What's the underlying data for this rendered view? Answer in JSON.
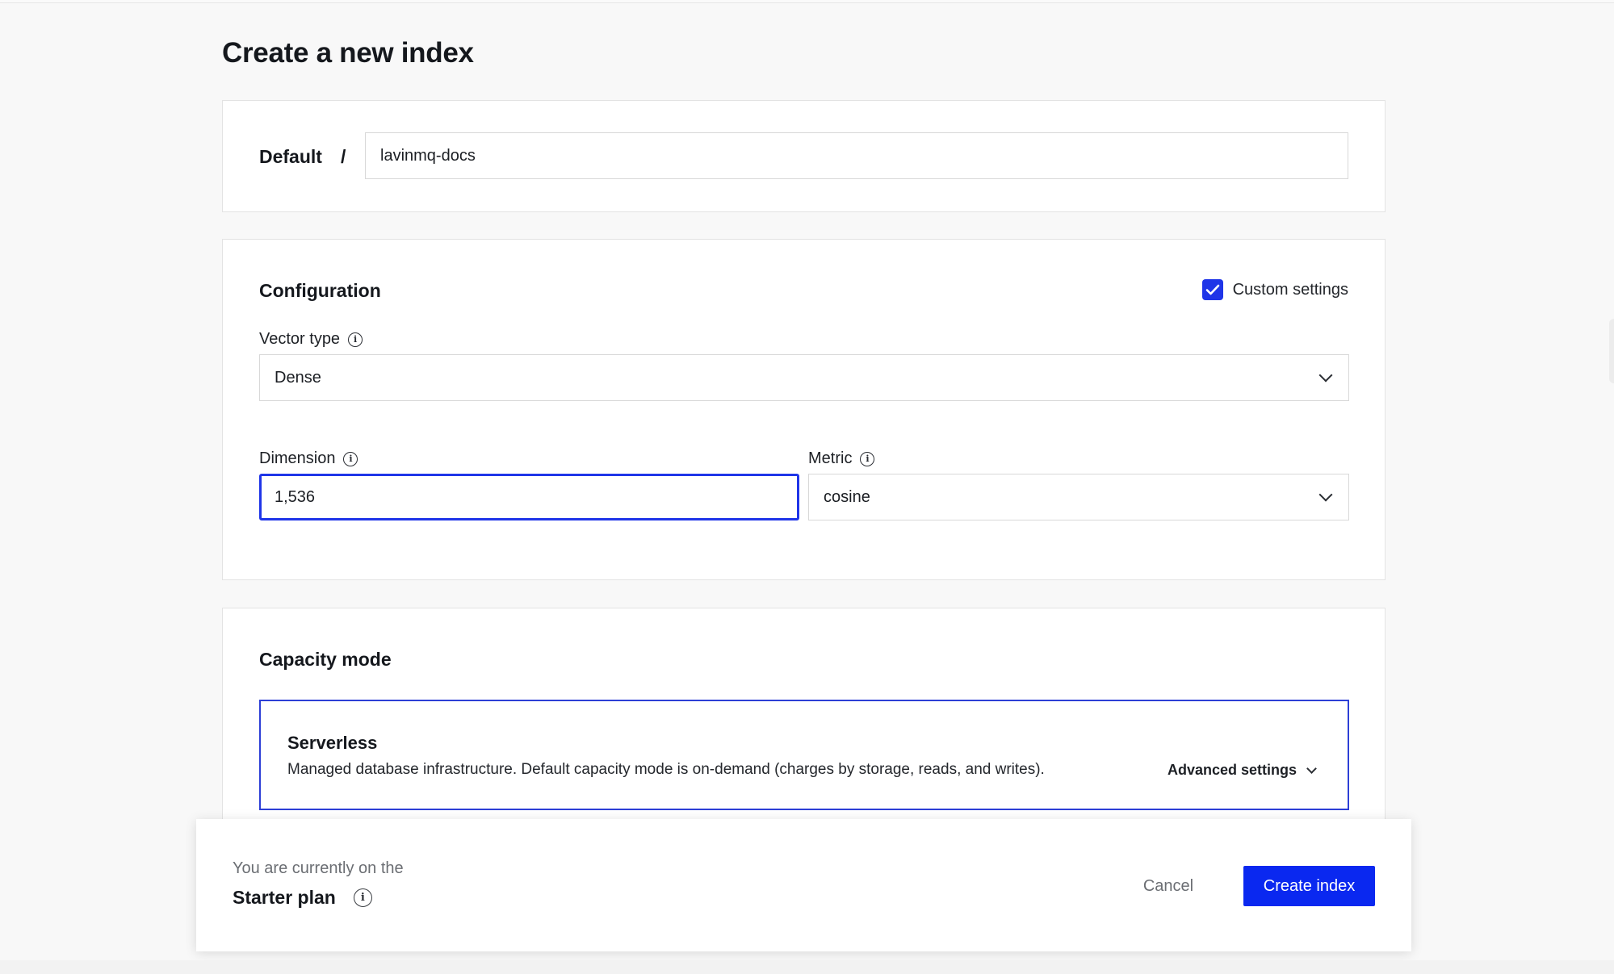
{
  "page": {
    "title": "Create a new index"
  },
  "name_card": {
    "namespace": "Default",
    "separator": "/",
    "index_name": "lavinmq-docs"
  },
  "configuration": {
    "title": "Configuration",
    "custom_settings_label": "Custom settings",
    "custom_settings_checked": true,
    "vector_type": {
      "label": "Vector type",
      "value": "Dense",
      "icon": "info-icon"
    },
    "dimension": {
      "label": "Dimension",
      "value": "1,536",
      "icon": "info-icon"
    },
    "metric": {
      "label": "Metric",
      "value": "cosine",
      "icon": "info-icon"
    }
  },
  "capacity": {
    "title": "Capacity mode",
    "serverless": {
      "title": "Serverless",
      "description": "Managed database infrastructure. Default capacity mode is on-demand (charges by storage, reads, and writes).",
      "advanced_label": "Advanced settings"
    }
  },
  "footer": {
    "plan_prefix": "You are currently on the",
    "plan_name": "Starter plan",
    "cancel_label": "Cancel",
    "create_label": "Create index"
  },
  "colors": {
    "accent": "#0a28f0",
    "page_background": "#f8f8f8",
    "card_background": "#ffffff"
  }
}
